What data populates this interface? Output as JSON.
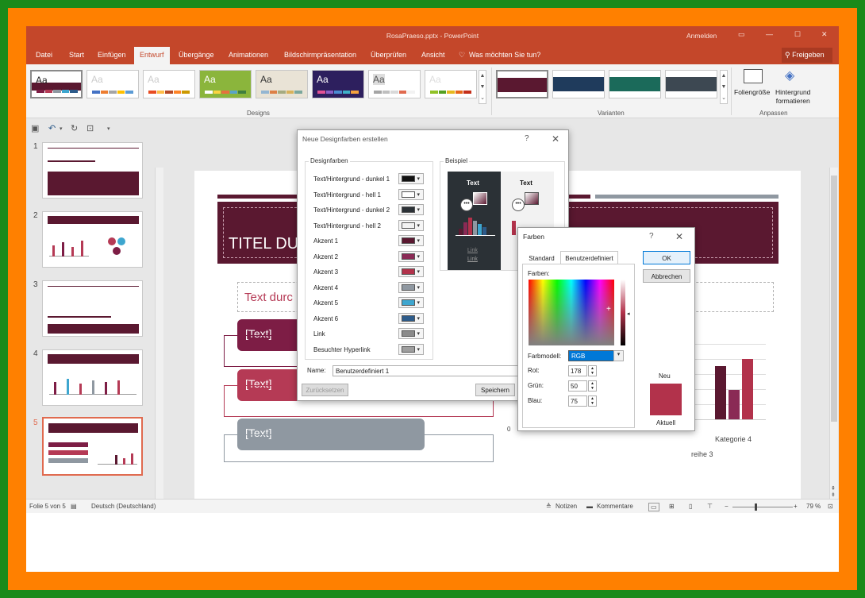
{
  "window": {
    "title": "RosaPraeso.pptx - PowerPoint",
    "login": "Anmelden"
  },
  "tabs": [
    "Datei",
    "Start",
    "Einfügen",
    "Entwurf",
    "Übergänge",
    "Animationen",
    "Bildschirmpräsentation",
    "Überprüfen",
    "Ansicht",
    "Was möchten Sie tun?"
  ],
  "share_label": "Freigeben",
  "ribbon": {
    "groups": {
      "designs": "Designs",
      "variants": "Varianten",
      "customize": "Anpassen"
    },
    "theme_aa": "Aa",
    "slide_size": "Foliengröße",
    "background": [
      "Hintergrund",
      "formatieren"
    ]
  },
  "colors": {
    "title_bar": "#c4472a",
    "accent_dark": "#5a1830",
    "accent1": "#7d1d45",
    "accent2": "#b53a55",
    "accent4": "#8f98a1",
    "accent5": "#3ea6cf",
    "accent6": "#2d5b8a"
  },
  "slides": [
    {
      "num": "1"
    },
    {
      "num": "2"
    },
    {
      "num": "3"
    },
    {
      "num": "4"
    },
    {
      "num": "5"
    }
  ],
  "slide": {
    "title": "TITEL DU",
    "text_box": "Text durc",
    "bullets": [
      "[Text]",
      "[Text]",
      "[Text]"
    ],
    "chart_label_category": "Kategorie 4",
    "chart_label_series": "reihe 3",
    "chart_zero": "0"
  },
  "design_dialog": {
    "title": "Neue Designfarben erstellen",
    "help": "?",
    "designfarben_label": "Designfarben",
    "beispiel_label": "Beispiel",
    "rows": [
      {
        "label": "Text/Hintergrund - dunkel 1",
        "color": "#111111"
      },
      {
        "label": "Text/Hintergrund - hell 1",
        "color": "#ffffff"
      },
      {
        "label": "Text/Hintergrund - dunkel 2",
        "color": "#2b3136"
      },
      {
        "label": "Text/Hintergrund - hell 2",
        "color": "#f2f2f2"
      },
      {
        "label": "Akzent 1",
        "color": "#5a1830"
      },
      {
        "label": "Akzent 2",
        "color": "#8a2a55"
      },
      {
        "label": "Akzent 3",
        "color": "#b2324b"
      },
      {
        "label": "Akzent 4",
        "color": "#8f98a1"
      },
      {
        "label": "Akzent 5",
        "color": "#3ea6cf"
      },
      {
        "label": "Akzent 6",
        "color": "#2d5b8a"
      },
      {
        "label": "Link",
        "color": "#8a8a8a"
      },
      {
        "label": "Besuchter Hyperlink",
        "color": "#9e9e9e"
      }
    ],
    "preview_text": "Text",
    "preview_link": "Link",
    "name_label": "Name:",
    "name_value": "Benutzerdefiniert 1",
    "reset_button": "Zurücksetzen",
    "save_button": "Speichern"
  },
  "color_dialog": {
    "title": "Farben",
    "help": "?",
    "tabs": [
      "Standard",
      "Benutzerdefiniert"
    ],
    "farben_label": "Farben:",
    "model_label": "Farbmodell:",
    "model_value": "RGB",
    "red_label": "Rot:",
    "red_value": "178",
    "green_label": "Grün:",
    "green_value": "50",
    "blue_label": "Blau:",
    "blue_value": "75",
    "ok": "OK",
    "cancel": "Abbrechen",
    "new_label": "Neu",
    "current_label": "Aktuell",
    "new_color": "#b2324b"
  },
  "status": {
    "slide_info": "Folie 5 von 5",
    "language": "Deutsch (Deutschland)",
    "notes": "Notizen",
    "comments": "Kommentare",
    "zoom": "79 %"
  }
}
